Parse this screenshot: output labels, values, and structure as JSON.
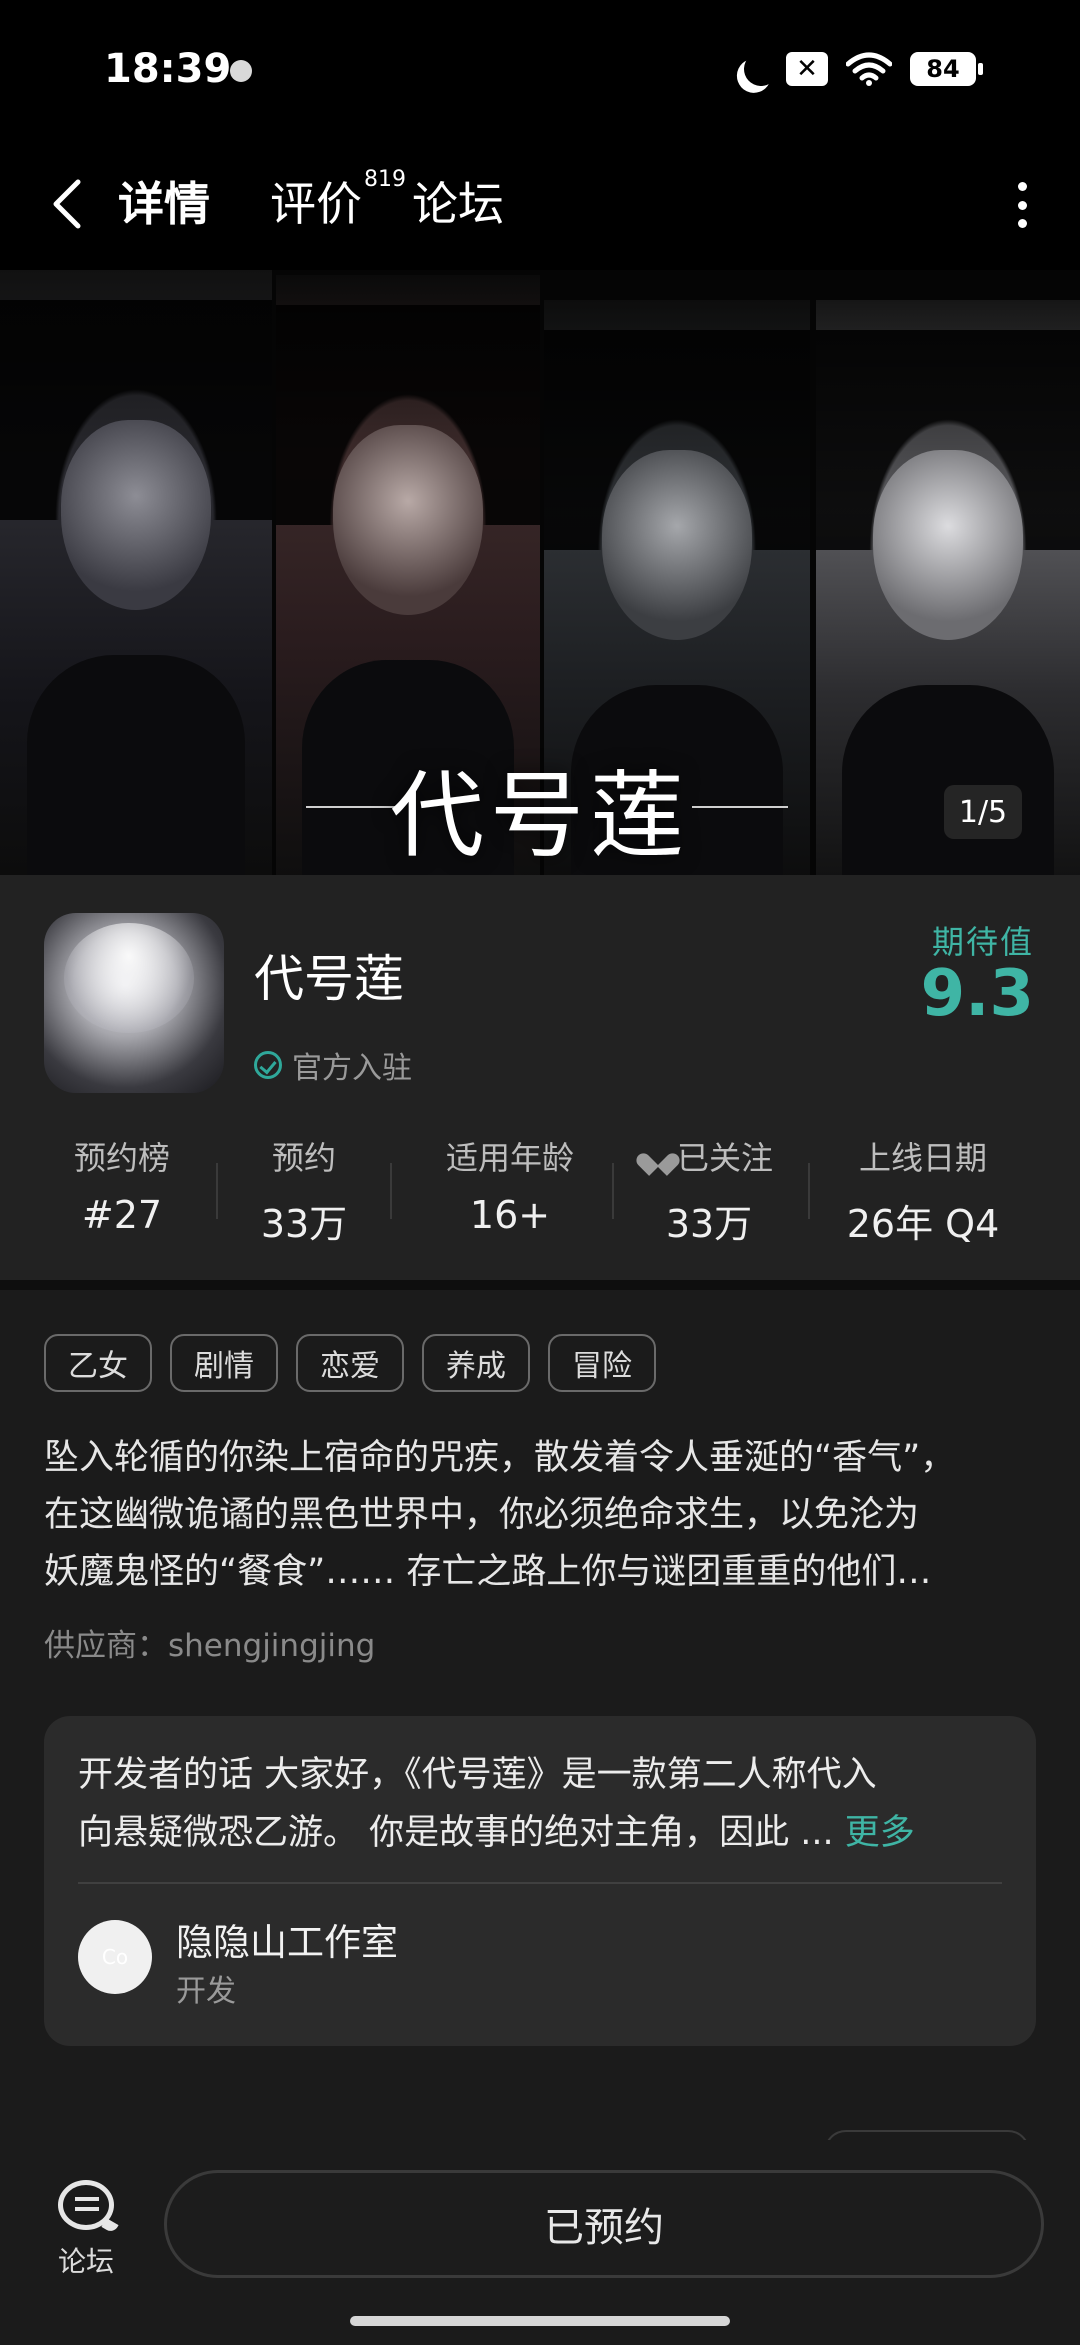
{
  "status_bar": {
    "time": "18:39",
    "battery": "84",
    "icons": [
      "moon-icon",
      "no-sim-icon",
      "wifi-icon",
      "battery-icon"
    ]
  },
  "nav": {
    "tabs": [
      {
        "label": "详情",
        "active": true
      },
      {
        "label": "评价",
        "badge": "819"
      },
      {
        "label": "论坛"
      }
    ]
  },
  "hero": {
    "title": "代号莲",
    "page_indicator": "1/5"
  },
  "app": {
    "name": "代号莲",
    "official_label": "官方入驻",
    "expect_label": "期待值",
    "expect_value": "9.3",
    "accent_color": "#3fb5a5"
  },
  "stats": [
    {
      "label": "预约榜",
      "value": "#27"
    },
    {
      "label": "预约",
      "value": "33万"
    },
    {
      "label": "适用年龄",
      "value": "16+"
    },
    {
      "label": "已关注",
      "value": "33万"
    },
    {
      "label": "上线日期",
      "value": "26年 Q4"
    }
  ],
  "tags": [
    "乙女",
    "剧情",
    "恋爱",
    "养成",
    "冒险"
  ],
  "description": {
    "lines": [
      "坠入轮循的你染上宿命的咒疾，散发着令人垂涎的“香气”，",
      "在这幽微诡谲的黑色世界中，你必须绝命求生，以免沦为",
      "妖魔鬼怪的“餐食”…… 存亡之路上你与谜团重重的他们…"
    ],
    "supplier": "供应商：shengjingjing"
  },
  "developer": {
    "line1": "开发者的话  大家好，《代号莲》是一款第二人称代入",
    "line2": "向悬疑微恐乙游。 你是故事的绝对主角，因此 ... ",
    "more": "更多",
    "studio_name": "隐隐山工作室",
    "studio_role": "开发",
    "avatar_text": "Co"
  },
  "bottom_bar": {
    "forum_label": "论坛",
    "reserve_label": "已预约"
  }
}
